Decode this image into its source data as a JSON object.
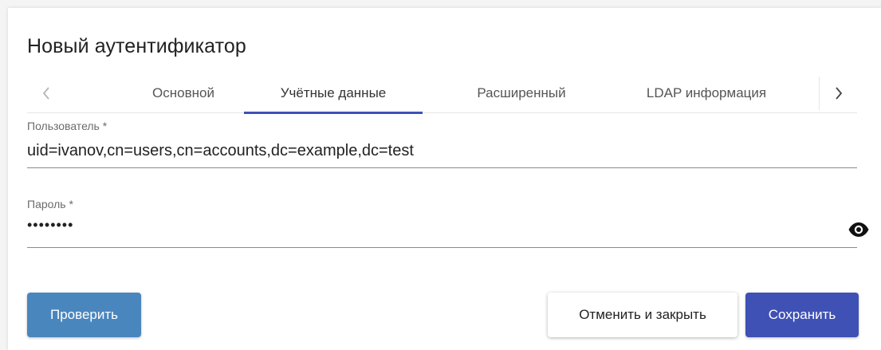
{
  "dialog": {
    "title": "Новый аутентификатор"
  },
  "tabs": {
    "items": [
      {
        "label": "Основной",
        "active": false
      },
      {
        "label": "Учётные данные",
        "active": true
      },
      {
        "label": "Расширенный",
        "active": false
      },
      {
        "label": "LDAP информация",
        "active": false
      }
    ],
    "prev_icon": "chevron-left-icon",
    "next_icon": "chevron-right-icon",
    "accent_color": "#3f51b5"
  },
  "form": {
    "user": {
      "label": "Пользователь *",
      "value": "uid=ivanov,cn=users,cn=accounts,dc=example,dc=test"
    },
    "password": {
      "label": "Пароль *",
      "masked_value": "••••••••",
      "toggle_icon": "eye-icon"
    }
  },
  "actions": {
    "check_label": "Проверить",
    "cancel_label": "Отменить и закрыть",
    "save_label": "Сохранить",
    "check_color": "#4a86be",
    "save_color": "#3f51b5"
  }
}
